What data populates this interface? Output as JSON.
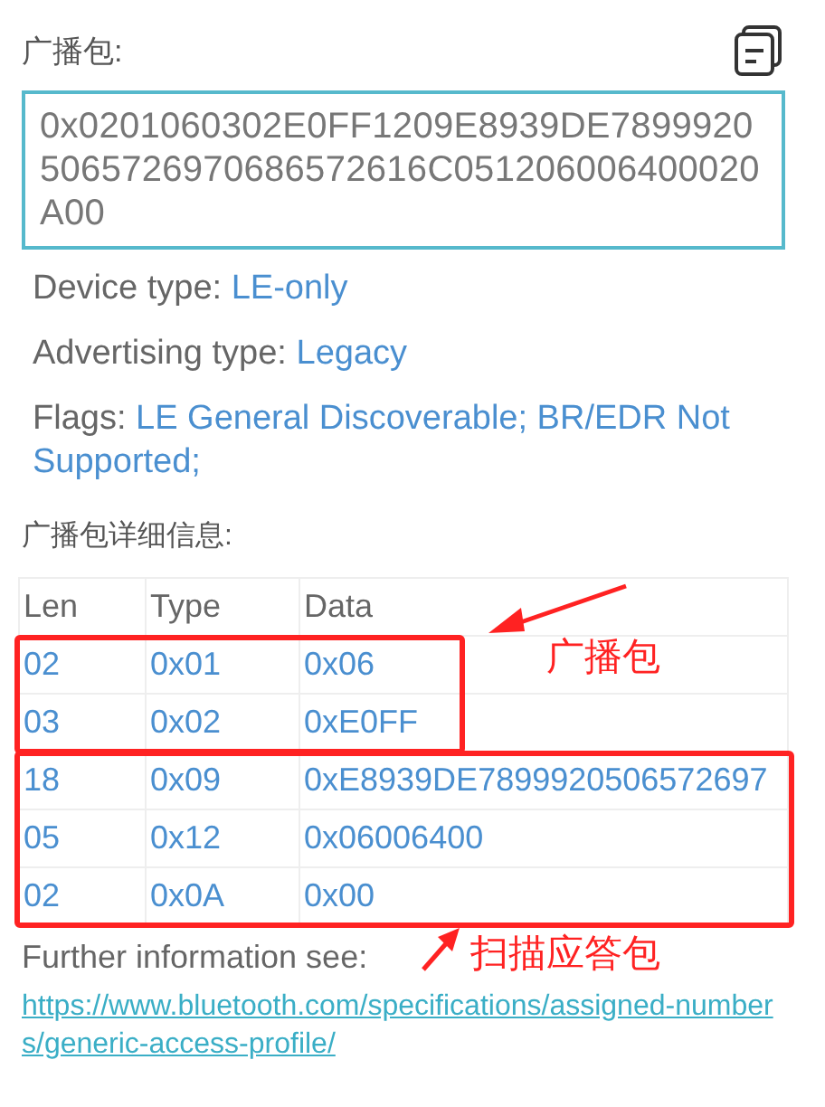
{
  "header": {
    "title": "广播包:"
  },
  "raw_data": {
    "value": "0x0201060302E0FF1209E8939DE78999205065726970686572616C051206006400020A00"
  },
  "info": [
    {
      "label": "Device type:",
      "value": "LE-only"
    },
    {
      "label": "Advertising type:",
      "value": "Legacy"
    },
    {
      "label": "Flags:",
      "value": "LE General Discoverable; BR/EDR Not Supported;"
    }
  ],
  "details_title": "广播包详细信息:",
  "table": {
    "columns": [
      "Len",
      "Type",
      "Data"
    ],
    "row_groups": [
      {
        "annotation": "广播包",
        "rows": [
          {
            "len": "02",
            "type": "0x01",
            "data": "0x06"
          },
          {
            "len": "03",
            "type": "0x02",
            "data": "0xE0FF"
          }
        ]
      },
      {
        "annotation": "扫描应答包",
        "rows": [
          {
            "len": "18",
            "type": "0x09",
            "data": "0xE8939DE7899920506572697"
          },
          {
            "len": "05",
            "type": "0x12",
            "data": "0x06006400"
          },
          {
            "len": "02",
            "type": "0x0A",
            "data": "0x00"
          }
        ]
      }
    ]
  },
  "footer": {
    "text": "Further information see:",
    "link": "https://www.bluetooth.com/specifications/assigned-numbers/generic-access-profile/"
  }
}
